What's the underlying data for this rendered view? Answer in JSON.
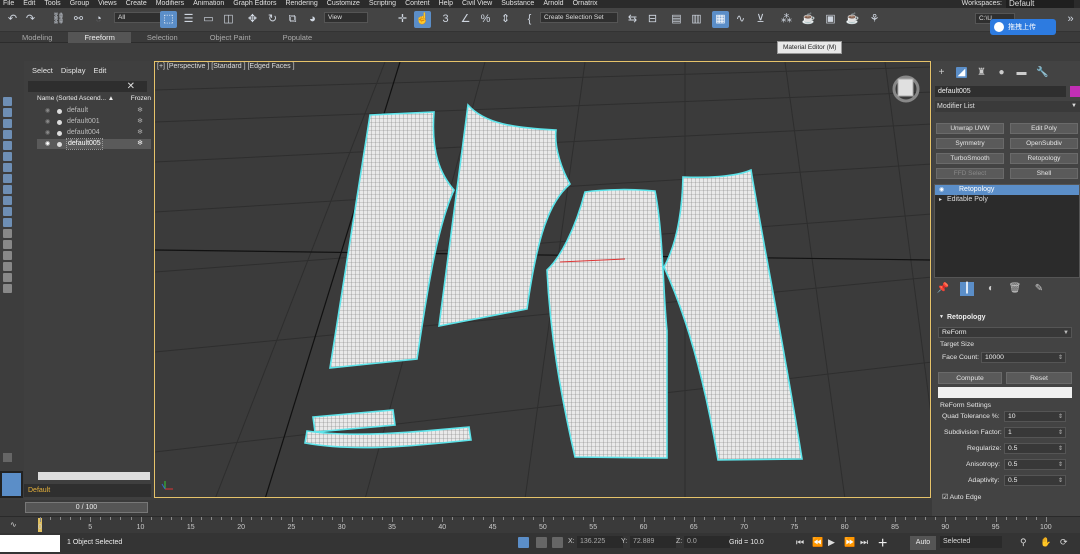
{
  "menu": {
    "items": [
      "File",
      "Edit",
      "Tools",
      "Group",
      "Views",
      "Create",
      "Modifiers",
      "Animation",
      "Graph Editors",
      "Rendering",
      "Customize",
      "Scripting",
      "Content",
      "Help",
      "Civil View",
      "Substance",
      "Arnold",
      "Ornatrix"
    ],
    "workspaces_label": "Workspaces:",
    "workspaces_value": "Default"
  },
  "toolbar": {
    "filter_value": "All",
    "ref_coord_value": "View",
    "selection_set_placeholder": "Create Selection Set",
    "path_value": "C:\\U"
  },
  "ribbon": {
    "tabs": [
      "Modeling",
      "Freeform",
      "Selection",
      "Object Paint",
      "Populate"
    ],
    "selected": "Freeform"
  },
  "tooltip": "Material Editor  (M)",
  "cloud_button": "拖拽上传",
  "explorer": {
    "menu": [
      "Select",
      "Display",
      "Edit"
    ],
    "col_name": "Name (Sorted Ascend... ▲",
    "col_frozen": "Frozen",
    "rows": [
      {
        "name": "default",
        "selected": false
      },
      {
        "name": "default001",
        "selected": false
      },
      {
        "name": "default004",
        "selected": false
      },
      {
        "name": "default005",
        "selected": true
      }
    ],
    "layer": "Default"
  },
  "viewport": {
    "label": "[+] [Perspective ] [Standard ] [Edged Faces ]"
  },
  "command_panel": {
    "object_name": "default005",
    "object_color": "#c22fb6",
    "modifier_list_label": "Modifier List",
    "buttons": [
      {
        "label": "Unwrap UVW",
        "disabled": false
      },
      {
        "label": "Edit Poly",
        "disabled": false
      },
      {
        "label": "Symmetry",
        "disabled": false
      },
      {
        "label": "OpenSubdiv",
        "disabled": false
      },
      {
        "label": "TurboSmooth",
        "disabled": false
      },
      {
        "label": "Retopology",
        "disabled": false
      },
      {
        "label": "FFD Select",
        "disabled": true
      },
      {
        "label": "Shell",
        "disabled": false
      }
    ],
    "stack": [
      {
        "label": "Retopology",
        "selected": true
      },
      {
        "label": "Editable Poly",
        "selected": false
      }
    ],
    "rollout_title": "Retopology",
    "method_value": "ReForm",
    "target_size_label": "Target Size",
    "face_count_label": "Face Count:",
    "face_count_value": "10000",
    "compute_label": "Compute",
    "reset_label": "Reset",
    "reform_settings_label": "ReForm Settings",
    "params": [
      {
        "label": "Quad Tolerance %:",
        "value": "10"
      },
      {
        "label": "Subdivision Factor:",
        "value": "1"
      },
      {
        "label": "Regularize:",
        "value": "0.5"
      },
      {
        "label": "Anisotropy:",
        "value": "0.5"
      },
      {
        "label": "Adaptivity:",
        "value": "0.5"
      }
    ],
    "auto_edge_label": "Auto Edge"
  },
  "timeline": {
    "frame_display": "0 / 100",
    "ticks": [
      "0",
      "5",
      "10",
      "15",
      "20",
      "25",
      "30",
      "35",
      "40",
      "45",
      "50",
      "55",
      "60",
      "65",
      "70",
      "75",
      "80",
      "85",
      "90",
      "95",
      "100"
    ]
  },
  "status": {
    "selection_text": "1 Object Selected",
    "x_label": "X:",
    "x_value": "136.225",
    "y_label": "Y:",
    "y_value": "72.889",
    "z_label": "Z:",
    "z_value": "0.0",
    "grid_text": "Grid = 10.0",
    "auto_label": "Auto",
    "selected_value": "Selected"
  }
}
